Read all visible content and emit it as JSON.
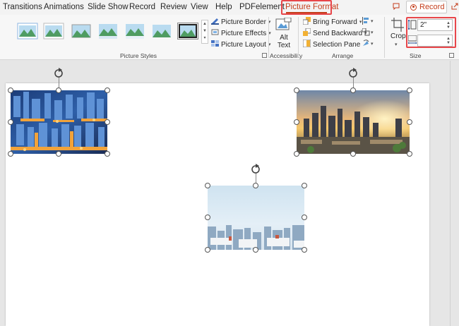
{
  "tabs": [
    "Transitions",
    "Animations",
    "Slide Show",
    "Record",
    "Review",
    "View",
    "Help",
    "PDFelement",
    "Picture Format"
  ],
  "active_tab": "Picture Format",
  "record_button": "Record",
  "ribbon": {
    "picture_styles_label": "Picture Styles",
    "picture_border": "Picture Border",
    "picture_effects": "Picture Effects",
    "picture_layout": "Picture Layout",
    "alt_text": "Alt Text",
    "accessibility_label": "Accessibility",
    "bring_forward": "Bring Forward",
    "send_backward": "Send Backward",
    "selection_pane": "Selection Pane",
    "arrange_label": "Arrange",
    "crop": "Crop",
    "height_value": "2\"",
    "width_value": "",
    "size_label": "Size"
  },
  "colors": {
    "accent": "#c43e1c",
    "highlight_box": "#e8464a"
  },
  "icons": [
    "comment-icon",
    "record-dot-icon",
    "share-icon",
    "alt-text-icon",
    "crop-icon",
    "height-icon",
    "width-icon",
    "rotate-icon"
  ]
}
